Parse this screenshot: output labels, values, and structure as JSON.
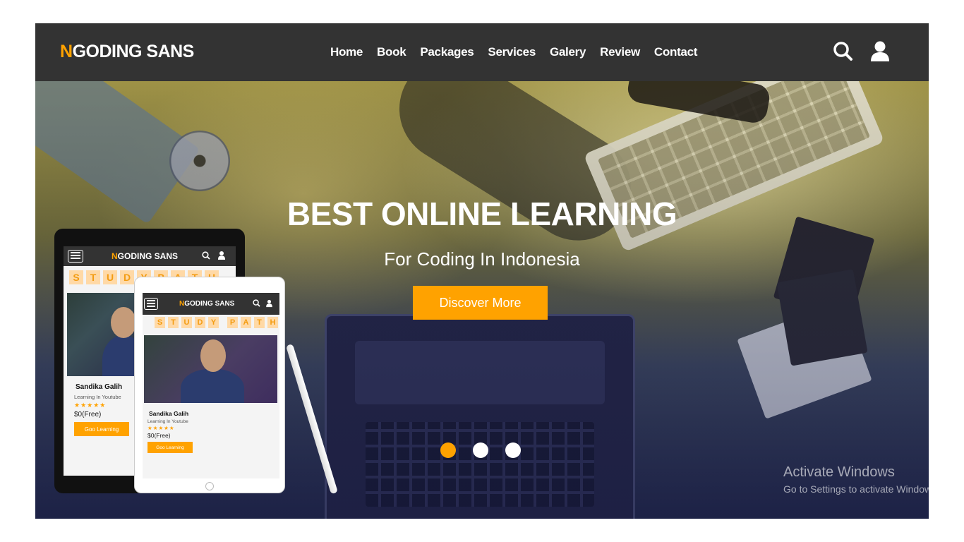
{
  "navbar": {
    "logo_accent": "N",
    "logo_rest": "GODING SANS",
    "links": [
      "Home",
      "Book",
      "Packages",
      "Services",
      "Galery",
      "Review",
      "Contact"
    ]
  },
  "hero": {
    "title": "BEST ONLINE LEARNING",
    "subtitle": "For Coding In Indonesia",
    "cta": "Discover More",
    "slides": 3,
    "active_slide": 1
  },
  "mockup": {
    "logo_accent": "N",
    "logo_rest": "GODING SANS",
    "study_path_back": [
      "S",
      "T",
      "U",
      "D",
      "Y",
      "P",
      "A",
      "T",
      "H"
    ],
    "study_path": [
      "S",
      "T",
      "U",
      "D",
      "Y",
      "P",
      "A",
      "T",
      "H"
    ],
    "card_name": "Sandika Galih",
    "card_subtitle": "Learning In Youtube",
    "stars": "★★★★★",
    "price": "$0(Free)",
    "button": "Goo Learning"
  },
  "watermark": {
    "line1": "Activate Windows",
    "line2": "Go to Settings to activate Windows."
  },
  "colors": {
    "accent": "#ffa200",
    "navbar_bg": "#333333"
  }
}
